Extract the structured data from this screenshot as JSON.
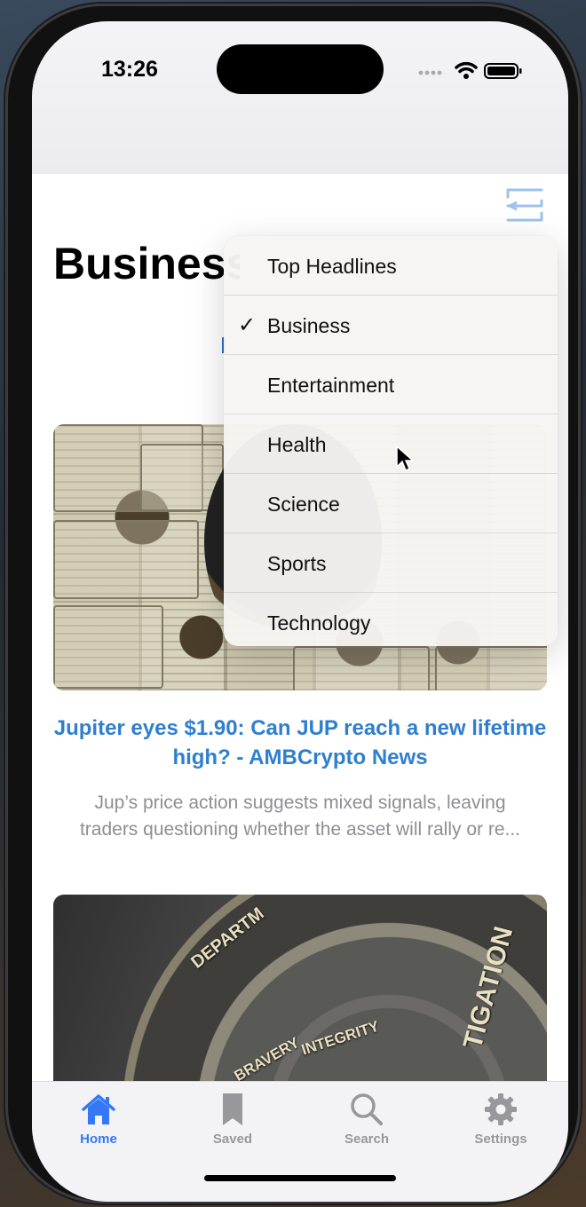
{
  "status": {
    "time": "13:26"
  },
  "header": {
    "title": "Business",
    "filter_icon": "filter-icon"
  },
  "dropdown": {
    "items": [
      {
        "label": "Top Headlines",
        "selected": false
      },
      {
        "label": "Business",
        "selected": true
      },
      {
        "label": "Entertainment",
        "selected": false
      },
      {
        "label": "Health",
        "selected": false
      },
      {
        "label": "Science",
        "selected": false
      },
      {
        "label": "Sports",
        "selected": false
      },
      {
        "label": "Technology",
        "selected": false
      }
    ],
    "check_mark": "✓"
  },
  "articles": [
    {
      "title": "Jupiter eyes $1.90: Can JUP reach a new lifetime high? - AMBCrypto News",
      "description_line1": "Jup’s price action suggests mixed signals, leaving",
      "description_line2": "traders questioning whether the asset will rally or re..."
    },
    {
      "image_text1": "INTEGRITY",
      "image_text2": "BRAVERY",
      "image_text3": "TIGATION",
      "image_text4": "DEPARTM"
    }
  ],
  "tabbar": {
    "tabs": [
      {
        "label": "Home",
        "icon": "home-icon",
        "active": true
      },
      {
        "label": "Saved",
        "icon": "bookmark-icon",
        "active": false
      },
      {
        "label": "Search",
        "icon": "search-icon",
        "active": false
      },
      {
        "label": "Settings",
        "icon": "gear-icon",
        "active": false
      }
    ]
  },
  "colors": {
    "accent": "#3478f6",
    "article_title": "#2f7fd0",
    "description": "#8e8e93"
  }
}
